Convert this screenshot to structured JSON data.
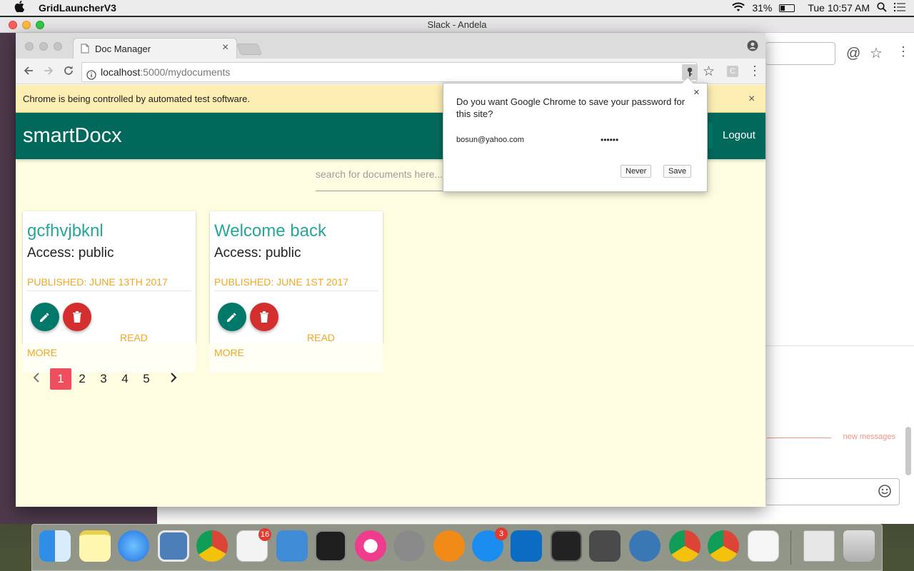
{
  "menubar": {
    "app_name": "GridLauncherV3",
    "battery": "31%",
    "clock": "Tue 10:57 AM"
  },
  "slack": {
    "window_title": "Slack - Andela",
    "new_messages_label": "new messages"
  },
  "chrome": {
    "tab_title": "Doc Manager",
    "url_host": "localhost",
    "url_path": ":5000/mydocuments",
    "infobar_text": "Chrome is being controlled by automated test software."
  },
  "password_bubble": {
    "question": "Do you want Google Chrome to save your password for this site?",
    "username": "bosun@yahoo.com",
    "password_mask": "••••••",
    "never_label": "Never",
    "save_label": "Save"
  },
  "app": {
    "brand": "smartDocx",
    "logout_label": "Logout",
    "search_placeholder": "search for documents here..."
  },
  "documents": [
    {
      "title": "gcfhvjbknl",
      "access": "Access: public",
      "published": "PUBLISHED: JUNE 13TH 2017",
      "read_label": "READ",
      "more_label": "MORE"
    },
    {
      "title": "Welcome back",
      "access": "Access: public",
      "published": "PUBLISHED: JUNE 1ST 2017",
      "read_label": "READ",
      "more_label": "MORE"
    }
  ],
  "pagination": {
    "pages": [
      "1",
      "2",
      "3",
      "4",
      "5"
    ],
    "active_page": "1"
  },
  "dock": {
    "slack_badge": "16",
    "appstore_badge": "3"
  },
  "colors": {
    "appbar": "#00695c",
    "card_title": "#26a69a",
    "accent_orange": "#f5a623",
    "edit_fab": "#00796b",
    "delete_fab": "#d32f2f",
    "page_active": "#ee4e5e"
  }
}
